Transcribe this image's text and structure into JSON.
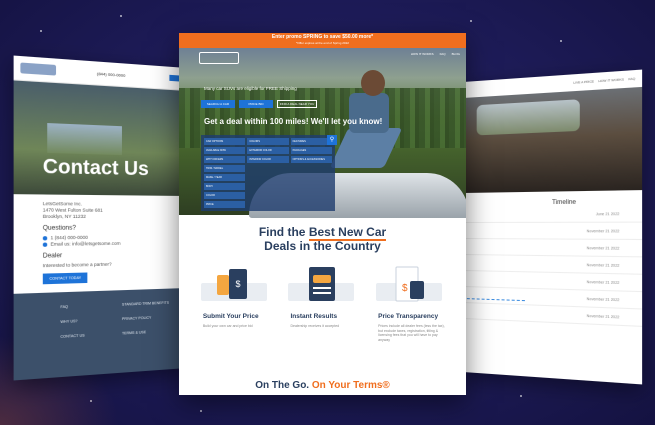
{
  "left": {
    "phone": "(844) 000-0000",
    "title": "Contact Us",
    "address_1": "LetsGetSome Inc.",
    "address_2": "1470 West Fulton Suite 681",
    "address_3": "Brooklyn, NY 11232",
    "questions": "Questions?",
    "phone_line": "1 (844) 000-0000",
    "email_line": "Email us: info@letsgetsome.com",
    "dealer": "Dealer",
    "dealer_line": "Interested to become a partner?",
    "cta": "CONTACT TODAY",
    "footer": [
      "FAQ",
      "STANDARD TRIM BENEFITS",
      "WHY US?",
      "PRIVACY POLICY",
      "CONTACT US",
      "TERMS & USE"
    ]
  },
  "center": {
    "promo_main": "Enter promo SPRING to save $50.00 more*",
    "promo_sub": "*Offer expires at the end of Spring 2022",
    "nav": [
      "HOW IT WORKS",
      "FAQ",
      "BLOG"
    ],
    "eligible": "Many car SUVs are eligible for FREE Shipping",
    "tabs": [
      "SEARCH A CAR",
      "PRICE BID",
      "FIND A DEAL NEAR YOU"
    ],
    "headline": "Get a deal within 100 miles! We'll let you know!",
    "filter_col1": [
      "CAR OPTIONS",
      "AVAILABLE NOW",
      "WITH OFFERS",
      "TRIM / MODEL",
      "MAKE / YEAR",
      "BODY",
      "COLOR",
      "PRICE"
    ],
    "filter_col2": [
      "COLORS",
      "EXTERIOR COLOR",
      "INTERIOR COLOR"
    ],
    "filter_col3": [
      "FEATURES",
      "PACKAGES",
      "OPTIONS & ACCESSORIES"
    ],
    "find_1": "Find the ",
    "find_hl": "Best New Car",
    "find_2": "Deals in the Country",
    "features": [
      {
        "title": "Submit Your Price",
        "desc": "Build your own car and price bid"
      },
      {
        "title": "Instant Results",
        "desc": "Dealership receives it accepted"
      },
      {
        "title": "Price Transparency",
        "desc": "Prices include all dealer fees (less the tax), but exclude taxes, registration, titling & licensing fees that you will have to pay anyway"
      }
    ],
    "otg_1": "On The Go. ",
    "otg_2": "On Your Terms®"
  },
  "right": {
    "nav": [
      "LIVE A PRICE",
      "HOW IT WORKS",
      "FAQ"
    ],
    "timeline": "Timeline",
    "dates": [
      "June 21 2022",
      "November 21 2022",
      "November 21 2022",
      "November 21 2022",
      "November 21 2022",
      "November 21 2022",
      "November 21 2022"
    ]
  }
}
